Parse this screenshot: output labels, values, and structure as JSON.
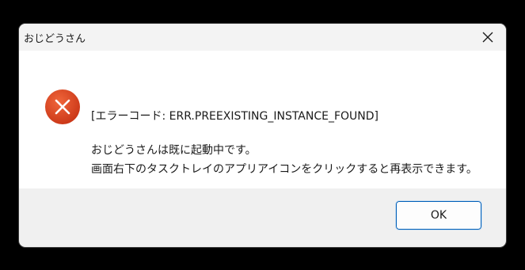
{
  "window": {
    "title": "おじどうさん"
  },
  "message": {
    "error_code_line": "[エラーコード: ERR.PREEXISTING_INSTANCE_FOUND]",
    "line1": "おじどうさんは既に起動中です。",
    "line2": "画面右下のタスクトレイのアプリアイコンをクリックすると再表示できます。"
  },
  "buttons": {
    "ok_label": "OK"
  },
  "icons": {
    "close": "close-icon",
    "error": "error-icon"
  },
  "colors": {
    "error_red": "#d9401b",
    "accent_blue": "#005fb8"
  }
}
